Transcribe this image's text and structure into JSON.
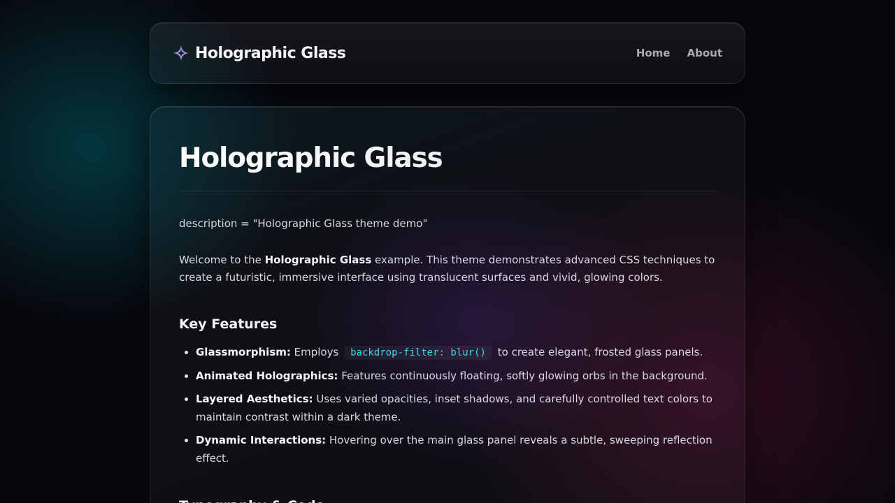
{
  "nav": {
    "brand": "Holographic Glass",
    "links": [
      "Home",
      "About"
    ]
  },
  "main": {
    "title": "Holographic Glass",
    "meta": "description = \"Holographic Glass theme demo\"",
    "intro": {
      "pre": "Welcome to the ",
      "strong": "Holographic Glass",
      "post": " example. This theme demonstrates advanced CSS techniques to create a futuristic, immersive interface using translucent surfaces and vivid, glowing colors."
    },
    "features_heading": "Key Features",
    "features": [
      {
        "label": "Glassmorphism:",
        "pre": " Employs",
        "code": "backdrop-filter: blur()",
        "post": "to create elegant, frosted glass panels."
      },
      {
        "label": "Animated Holographics:",
        "text": " Features continuously floating, softly glowing orbs in the background."
      },
      {
        "label": "Layered Aesthetics:",
        "text": " Uses varied opacities, inset shadows, and carefully controlled text colors to maintain contrast within a dark theme."
      },
      {
        "label": "Dynamic Interactions:",
        "text": " Hovering over the main glass panel reveals a subtle, sweeping reflection effect."
      }
    ],
    "typography_heading": "Typography & Code"
  },
  "colors": {
    "accent_code": "#37d7e8",
    "background": "#07070d",
    "glow_teal": "#006e78",
    "glow_magenta": "#6e143c"
  }
}
